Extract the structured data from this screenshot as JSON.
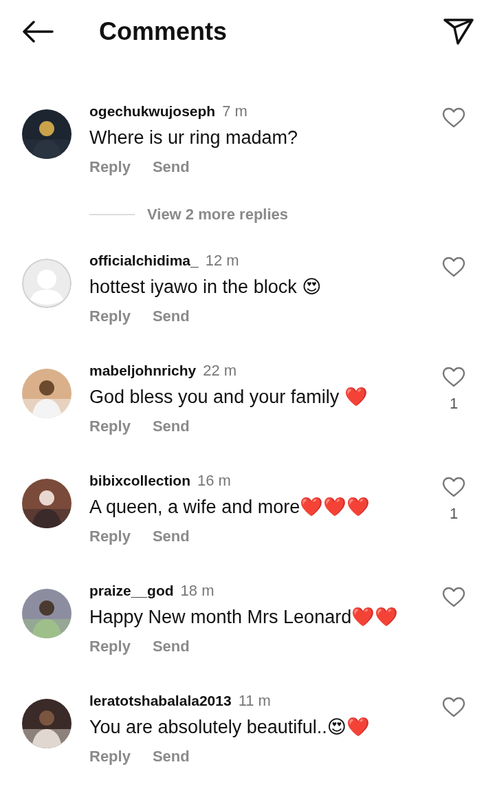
{
  "header": {
    "title": "Comments"
  },
  "comments": [
    {
      "username": "ogechukwujoseph",
      "time": "7 m",
      "text": "Where is ur ring madam?",
      "actions": [
        "Reply",
        "Send"
      ],
      "liked": false,
      "view_more": "View 2 more replies"
    },
    {
      "avatar": {
        "kind": "default"
      },
      "username": "officialchidima_",
      "time": "12 m",
      "text": "hottest iyawo in the block 😍",
      "actions": [
        "Reply",
        "Send"
      ],
      "liked": false
    },
    {
      "username": "mabeljohnrichy",
      "time": "22 m",
      "text": "God bless you and your family ❤️",
      "actions": [
        "Reply",
        "Send"
      ],
      "liked": false,
      "likes": "1"
    },
    {
      "username": "bibixcollection",
      "time": "16 m",
      "text": "A queen, a wife and more❤️❤️❤️",
      "actions": [
        "Reply",
        "Send"
      ],
      "liked": false,
      "likes": "1"
    },
    {
      "username": "praize__god",
      "time": "18 m",
      "text": "Happy New month Mrs Leonard❤️❤️",
      "actions": [
        "Reply",
        "Send"
      ],
      "liked": false
    },
    {
      "username": "leratotshabalala2013",
      "time": "11 m",
      "text": "You are absolutely beautiful..😍❤️",
      "actions": [
        "Reply",
        "Send"
      ],
      "liked": false
    }
  ]
}
